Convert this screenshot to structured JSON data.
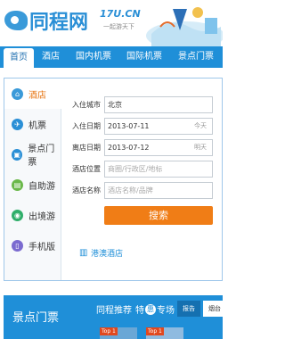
{
  "header": {
    "logo_text": "同程网",
    "domain": "17U.CN",
    "slogan": "一起游天下"
  },
  "nav": {
    "items": [
      {
        "label": "首页",
        "active": true
      },
      {
        "label": "酒店",
        "active": false
      },
      {
        "label": "国内机票",
        "active": false
      },
      {
        "label": "国际机票",
        "active": false
      },
      {
        "label": "景点门票",
        "active": false
      }
    ]
  },
  "sidebar": {
    "items": [
      {
        "label": "酒店",
        "icon": "house-icon",
        "color": "#3a9ad9",
        "active": true
      },
      {
        "label": "机票",
        "icon": "plane-icon",
        "color": "#2a8fd6",
        "active": false
      },
      {
        "label": "景点门票",
        "icon": "ticket-icon",
        "color": "#2a8fd6",
        "active": false
      },
      {
        "label": "自助游",
        "icon": "bag-icon",
        "color": "#6ab84a",
        "active": false
      },
      {
        "label": "出境游",
        "icon": "globe-icon",
        "color": "#2fae6a",
        "active": false
      },
      {
        "label": "手机版",
        "icon": "phone-icon",
        "color": "#7b6bd0",
        "active": false
      }
    ]
  },
  "form": {
    "city_label": "入住城市",
    "city_value": "北京",
    "checkin_label": "入住日期",
    "checkin_value": "2013-07-11",
    "checkin_weekday": "今天",
    "checkout_label": "离店日期",
    "checkout_value": "2013-07-12",
    "checkout_weekday": "明天",
    "location_label": "酒店位置",
    "location_placeholder": "商圈/行政区/地标",
    "name_label": "酒店名称",
    "name_placeholder": "酒店名称/品牌",
    "search_label": "搜索"
  },
  "links": {
    "hk_macau_hotels": "港澳酒店"
  },
  "scenic": {
    "title": "景点门票",
    "banner_prefix": "同程推荐",
    "banner_mid1": "特",
    "banner_badge": "惠",
    "banner_suffix": "专场",
    "tab1": "报告",
    "tab2": "烟台",
    "photo_tag": "Top 1"
  },
  "colors": {
    "brand_blue": "#1f8fd8",
    "accent_orange": "#f07d16"
  }
}
